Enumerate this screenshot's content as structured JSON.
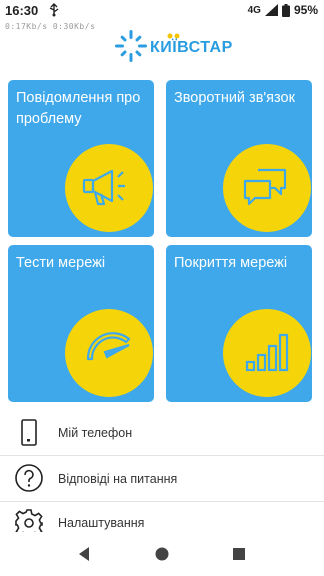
{
  "status_bar": {
    "time": "16:30",
    "network": "4G",
    "battery": "95%",
    "speed": "0:17Kb/s   0:30Kb/s"
  },
  "brand": {
    "name": "КИЇВСТАР",
    "color": "#2a9de0"
  },
  "tiles": [
    {
      "title": "Повідомлення про проблему",
      "icon": "megaphone-icon"
    },
    {
      "title": "Зворотний зв'язок",
      "icon": "chat-bubbles-icon"
    },
    {
      "title": "Тести мережі",
      "icon": "speedometer-icon"
    },
    {
      "title": "Покриття мережі",
      "icon": "signal-bars-icon"
    }
  ],
  "menu": [
    {
      "label": "Мій телефон",
      "icon": "phone-icon"
    },
    {
      "label": "Відповіді на питання",
      "icon": "question-icon"
    },
    {
      "label": "Налаштування",
      "icon": "gear-icon"
    }
  ],
  "colors": {
    "tile": "#3fa8ea",
    "circle": "#f5d50a",
    "icon": "#3fa8ea"
  },
  "nav": [
    "back-icon",
    "home-icon",
    "recents-icon"
  ]
}
